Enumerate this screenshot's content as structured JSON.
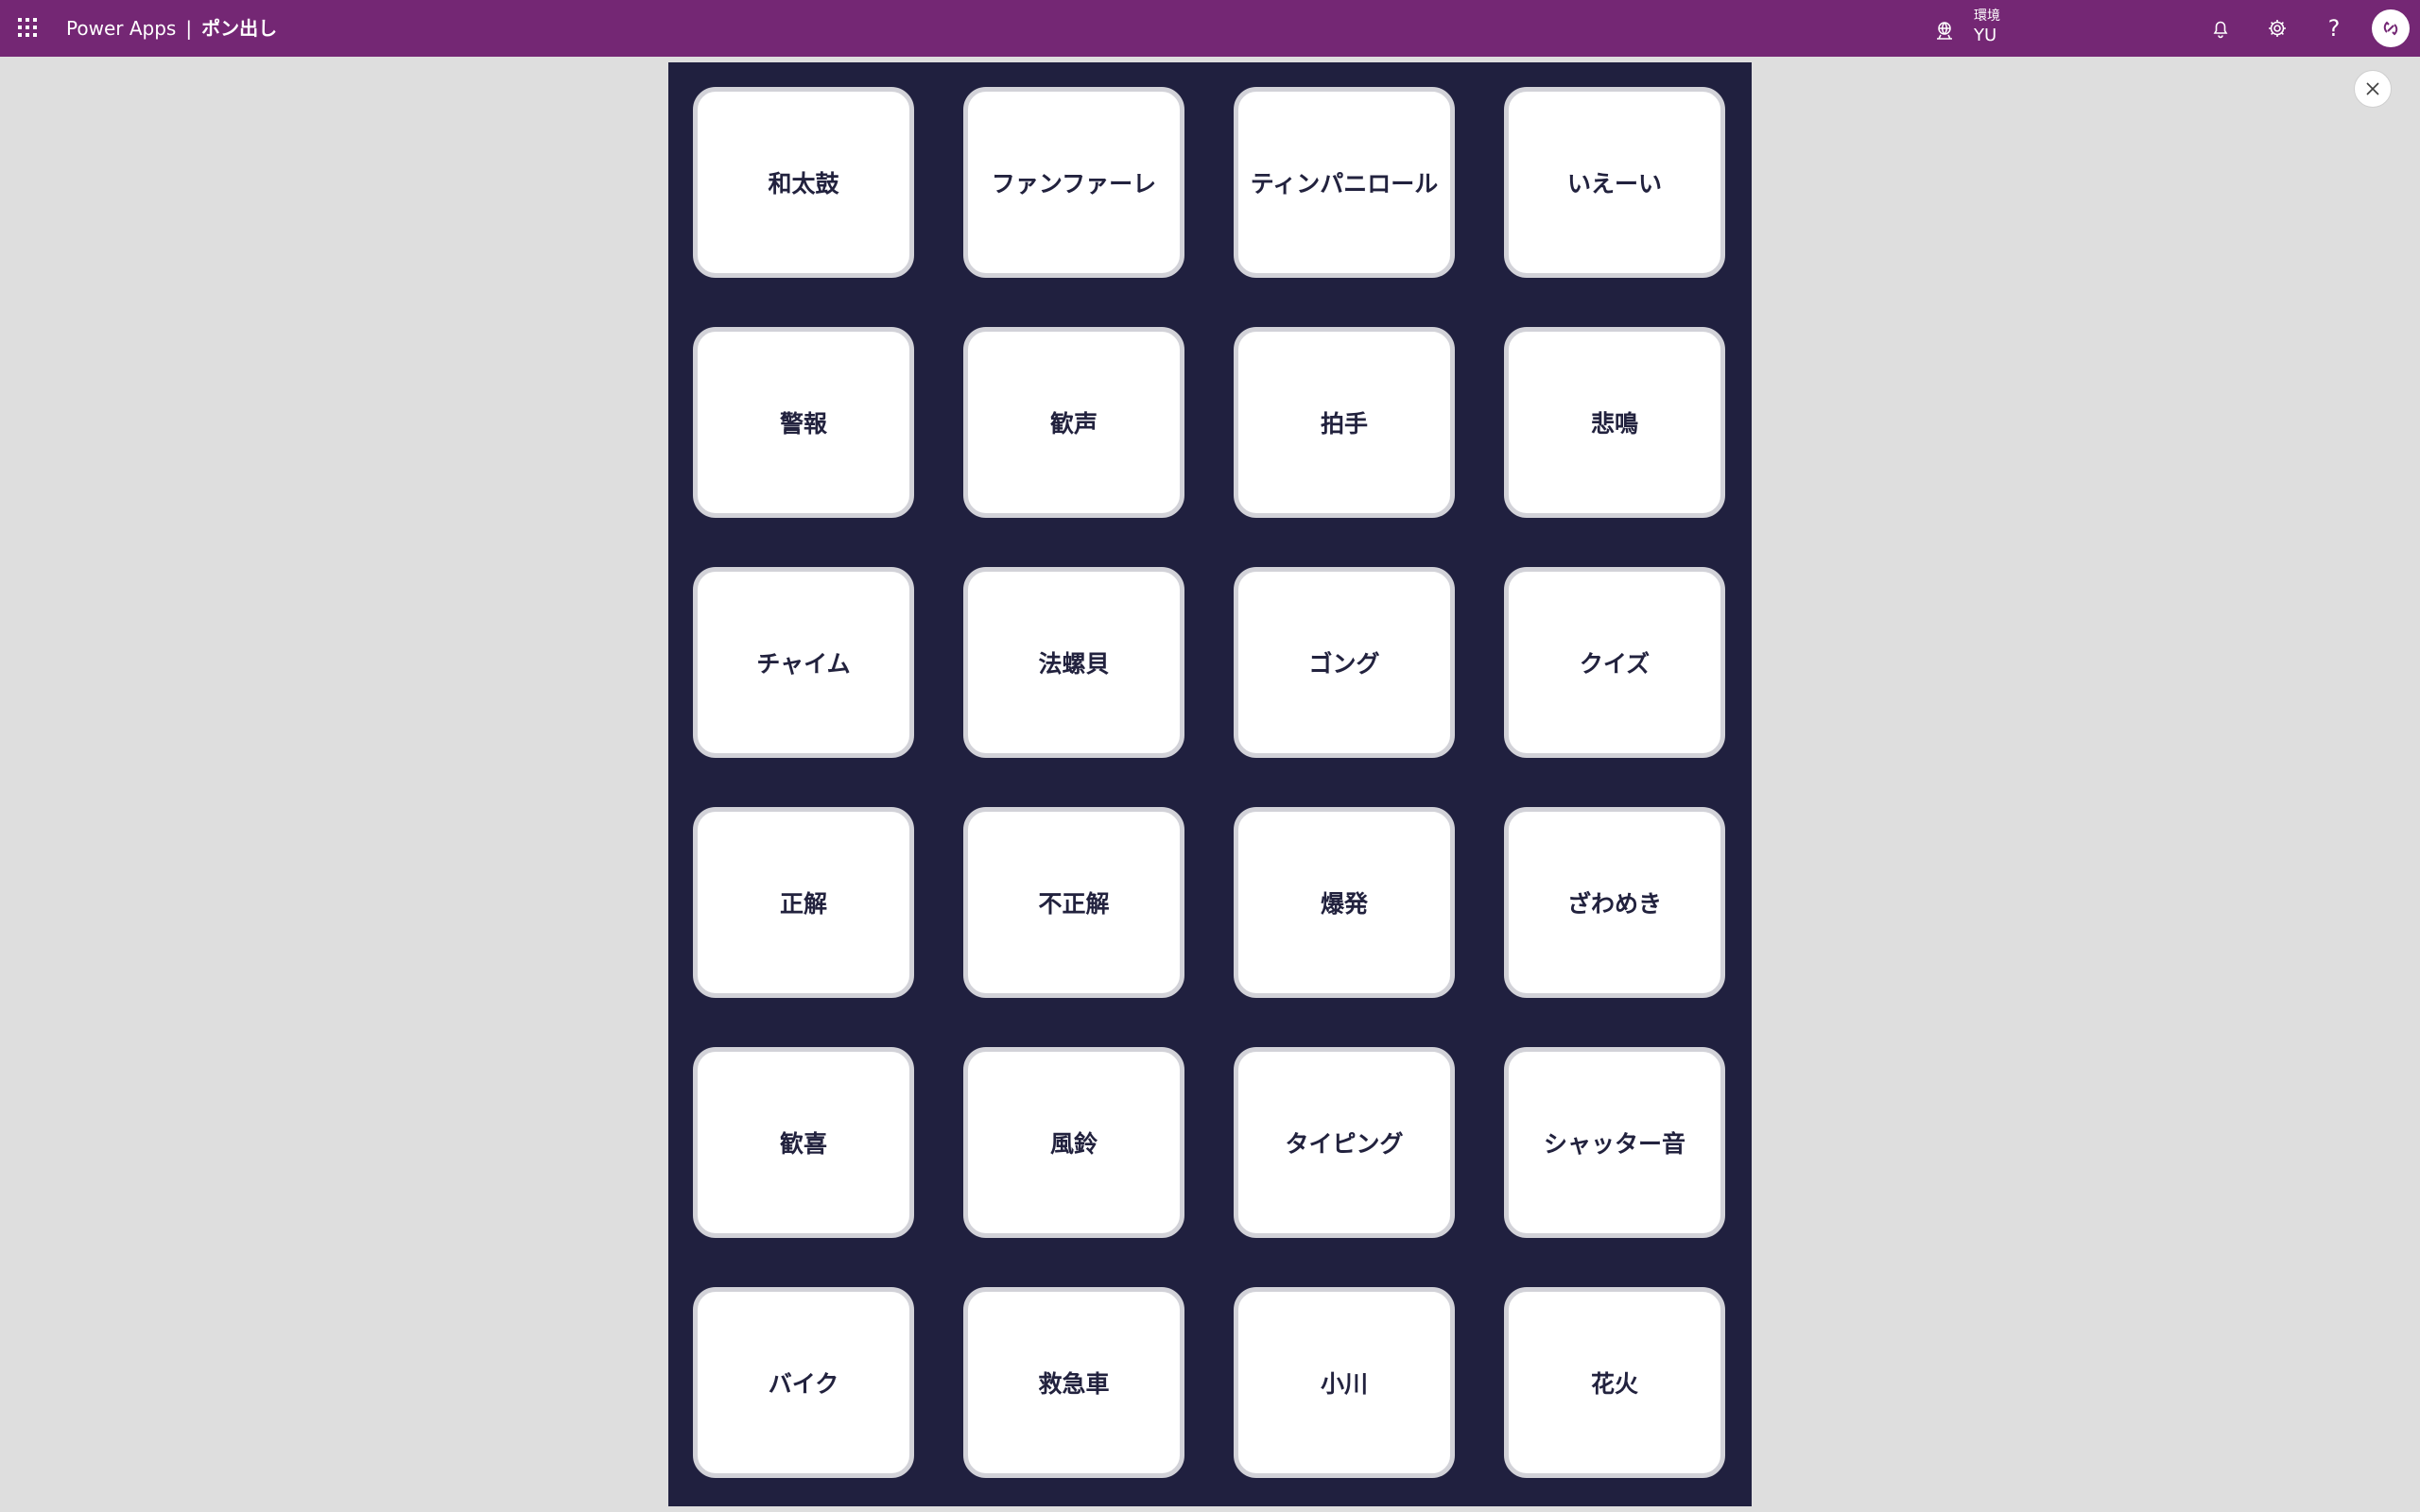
{
  "header": {
    "product": "Power Apps",
    "separator": "|",
    "app_name": "ポン出し",
    "environment_label": "環境",
    "environment_name": "YU",
    "help_label": "?",
    "icons": {
      "waffle": "app-launcher-icon",
      "environment": "environment-icon",
      "notifications": "bell-icon",
      "settings": "gear-icon",
      "avatar": "user-avatar-icon"
    },
    "bar_color": "#742774"
  },
  "canvas": {
    "background_color": "#20203f",
    "buttons": [
      "和太鼓",
      "ファンファーレ",
      "ティンパニロール",
      "いえーい",
      "警報",
      "歓声",
      "拍手",
      "悲鳴",
      "チャイム",
      "法螺貝",
      "ゴング",
      "クイズ",
      "正解",
      "不正解",
      "爆発",
      "ざわめき",
      "歓喜",
      "風鈴",
      "タイピング",
      "シャッター音",
      "バイク",
      "救急車",
      "小川",
      "花火"
    ]
  },
  "close_button": {
    "icon": "close-icon"
  }
}
